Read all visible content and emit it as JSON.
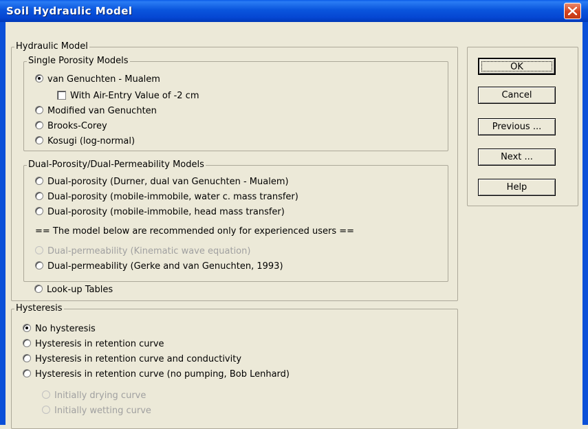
{
  "window": {
    "title": "Soil Hydraulic Model"
  },
  "hydraulic": {
    "legend": "Hydraulic Model",
    "single": {
      "legend": "Single Porosity Models",
      "vg": "van Genuchten - Mualem",
      "air_entry": "With Air-Entry Value of -2 cm",
      "modified_vg": "Modified van Genuchten",
      "brooks": "Brooks-Corey",
      "kosugi": "Kosugi (log-normal)"
    },
    "dual": {
      "legend": "Dual-Porosity/Dual-Permeability Models",
      "durner": "Dual-porosity (Durner, dual van Genuchten - Mualem)",
      "mobile_water": "Dual-porosity (mobile-immobile, water c. mass transfer)",
      "mobile_head": "Dual-porosity (mobile-immobile, head mass transfer)",
      "warning": "== The model below are recommended only for experienced users ==",
      "kinematic": "Dual-permeability (Kinematic wave equation)",
      "gerke": "Dual-permeability (Gerke and van Genuchten, 1993)"
    },
    "lookup": "Look-up Tables"
  },
  "hysteresis": {
    "legend": "Hysteresis",
    "none": "No hysteresis",
    "retention": "Hysteresis in retention curve",
    "retention_cond": "Hysteresis in retention curve and conductivity",
    "lenhard": "Hysteresis in retention curve  (no pumping, Bob Lenhard)",
    "drying": "Initially drying curve",
    "wetting": "Initially wetting curve"
  },
  "buttons": {
    "ok": "OK",
    "cancel": "Cancel",
    "previous": "Previous ...",
    "next": "Next ...",
    "help": "Help"
  }
}
